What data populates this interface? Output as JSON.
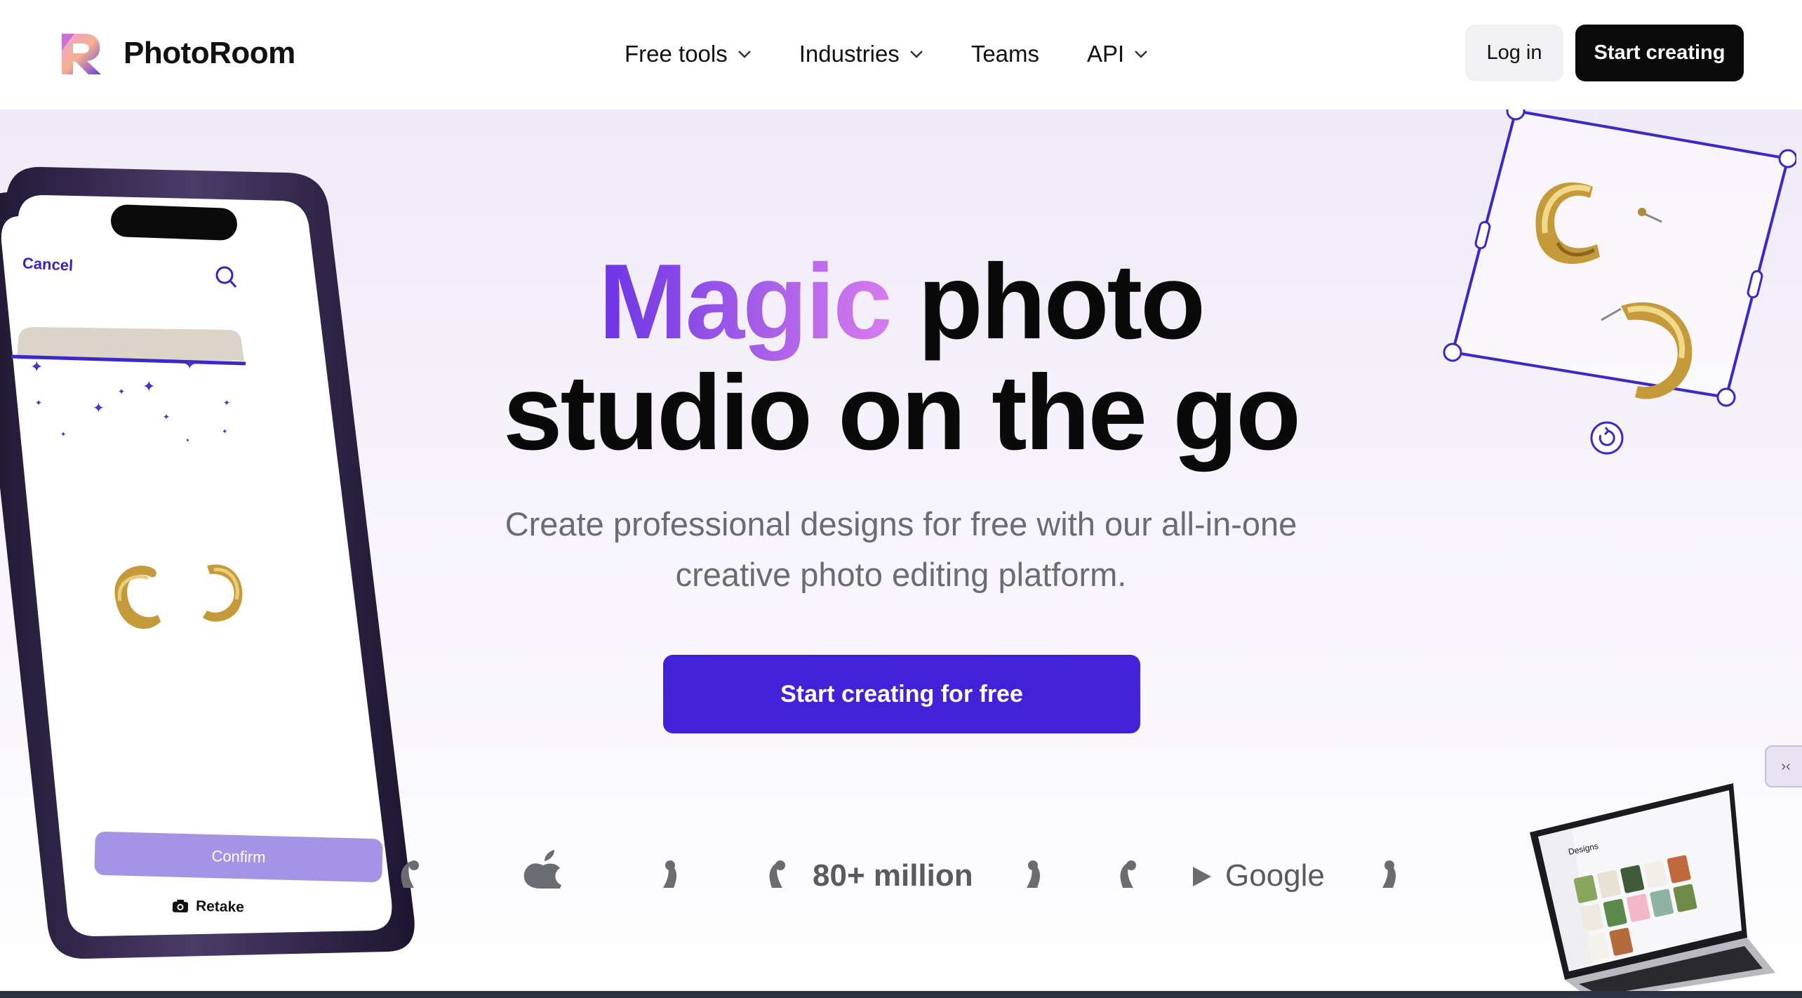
{
  "brand": {
    "name": "PhotoRoom"
  },
  "nav": {
    "items": [
      {
        "label": "Free tools",
        "has_dropdown": true
      },
      {
        "label": "Industries",
        "has_dropdown": true
      },
      {
        "label": "Teams",
        "has_dropdown": false
      },
      {
        "label": "API",
        "has_dropdown": true
      }
    ],
    "login_label": "Log in",
    "start_label": "Start creating"
  },
  "hero": {
    "headline_accent": "Magic",
    "headline_rest": " photo",
    "headline_line2": "studio on the go",
    "subtitle": "Create professional designs for free with our all-in-one creative photo editing platform.",
    "cta_label": "Start creating for free"
  },
  "phone": {
    "cancel_label": "Cancel",
    "confirm_label": "Confirm",
    "retake_label": "Retake"
  },
  "laptop": {
    "screen_title": "Designs"
  },
  "stats": {
    "users_text": "80+ million",
    "store_google": "Google"
  },
  "colors": {
    "accent": "#4122d9",
    "magic_gradient_start": "#6d33e6",
    "magic_gradient_end": "#d87bf0",
    "phone_frame": "#2a1f3d",
    "selection_stroke": "#3b28c8"
  },
  "icons": [
    "logo-mark-icon",
    "chevron-down-icon",
    "search-icon",
    "camera-icon",
    "rotate-icon",
    "apple-icon",
    "google-play-icon",
    "laurel-icon"
  ]
}
